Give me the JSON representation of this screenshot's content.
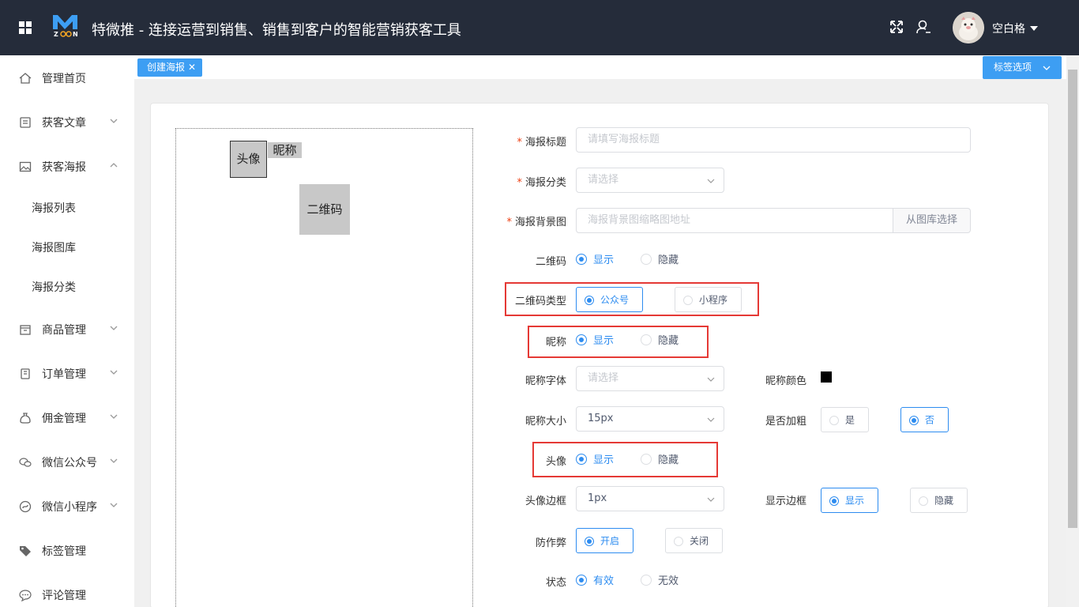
{
  "header": {
    "title": "特微推 - 连接运营到销售、销售到客户的智能营销获客工具",
    "user_name": "空白格",
    "bg_color": "#252c3a"
  },
  "sidebar": {
    "items": [
      {
        "label": "管理首页",
        "icon": "home-icon"
      },
      {
        "label": "获客文章",
        "icon": "article-icon"
      },
      {
        "label": "获客海报",
        "icon": "image-icon"
      },
      {
        "label": "海报列表"
      },
      {
        "label": "海报图库"
      },
      {
        "label": "海报分类"
      },
      {
        "label": "商品管理",
        "icon": "shop-icon"
      },
      {
        "label": "订单管理",
        "icon": "order-icon"
      },
      {
        "label": "佣金管理",
        "icon": "money-bag-icon"
      },
      {
        "label": "微信公众号",
        "icon": "wechat-icon"
      },
      {
        "label": "微信小程序",
        "icon": "miniprogram-icon"
      },
      {
        "label": "标签管理",
        "icon": "tag-icon"
      },
      {
        "label": "评论管理",
        "icon": "comment-icon"
      }
    ]
  },
  "tabs": {
    "active": "创建海报",
    "options_label": "标签选项"
  },
  "preview": {
    "avatar": "头像",
    "nickname": "昵称",
    "qrcode": "二维码"
  },
  "form": {
    "title_label": "海报标题",
    "title_placeholder": "请填写海报标题",
    "category_label": "海报分类",
    "category_placeholder": "请选择",
    "bg_label": "海报背景图",
    "bg_placeholder": "海报背景图缩略图地址",
    "bg_button": "从图库选择",
    "qr_label": "二维码",
    "qr_show": "显示",
    "qr_hide": "隐藏",
    "qr_type_label": "二维码类型",
    "qr_type_mp": "公众号",
    "qr_type_mini": "小程序",
    "nick_label": "昵称",
    "nick_show": "显示",
    "nick_hide": "隐藏",
    "nick_font_label": "昵称字体",
    "nick_font_placeholder": "请选择",
    "nick_color_label": "昵称颜色",
    "nick_color": "#000000",
    "nick_size_label": "昵称大小",
    "nick_size_value": "15px",
    "bold_label": "是否加粗",
    "bold_yes": "是",
    "bold_no": "否",
    "avatar_label": "头像",
    "avatar_show": "显示",
    "avatar_hide": "隐藏",
    "avatar_border_label": "头像边框",
    "avatar_border_value": "1px",
    "show_border_label": "显示边框",
    "show_border_show": "显示",
    "show_border_hide": "隐藏",
    "anticheat_label": "防作弊",
    "anticheat_on": "开启",
    "anticheat_off": "关闭",
    "status_label": "状态",
    "status_valid": "有效",
    "status_invalid": "无效"
  }
}
